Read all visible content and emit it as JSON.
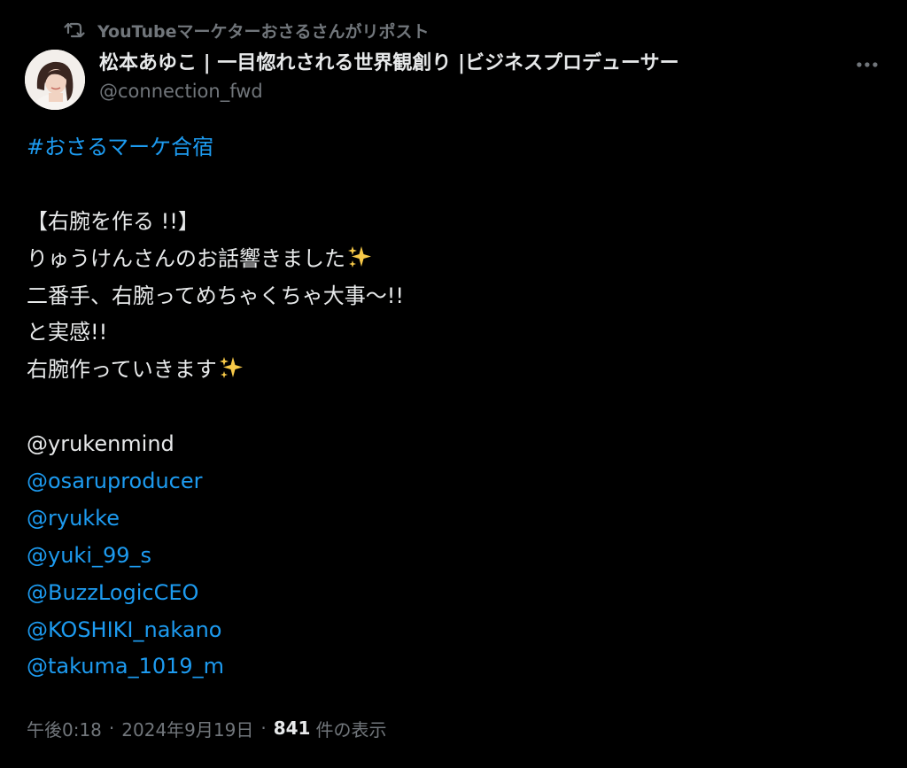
{
  "repost": {
    "label": "YouTubeマーケターおさるさんがリポスト"
  },
  "author": {
    "display_name": "松本あゆこ | 一目惚れされる世界観創り |ビジネスプロデューサー",
    "handle": "@connection_fwd"
  },
  "post": {
    "hashtag": "#おさるマーケ合宿",
    "line_title": "【右腕を作る !!】",
    "line_1": "りゅうけんさんのお話響きました",
    "line_2": "二番手、右腕ってめちゃくちゃ大事〜!!",
    "line_3": "と実感!!",
    "line_4": "右腕作っていきます",
    "mention_plain": "@yrukenmind",
    "mentions": [
      "@osaruproducer",
      "@ryukke",
      "@yuki_99_s",
      "@BuzzLogicCEO",
      "@KOSHIKI_nakano",
      "@takuma_1019_m"
    ]
  },
  "meta": {
    "time": "午後0:18",
    "separator": "·",
    "date": "2024年9月19日",
    "views_count": "841",
    "views_label": "件の表示"
  },
  "colors": {
    "background": "#000000",
    "text": "#e7e9ea",
    "secondary": "#71767b",
    "link": "#1d9bf0",
    "sparkle": "#f7c948"
  },
  "icons": {
    "repost": "repost-icon",
    "more": "more-dots-icon",
    "sparkle": "sparkles-emoji"
  }
}
